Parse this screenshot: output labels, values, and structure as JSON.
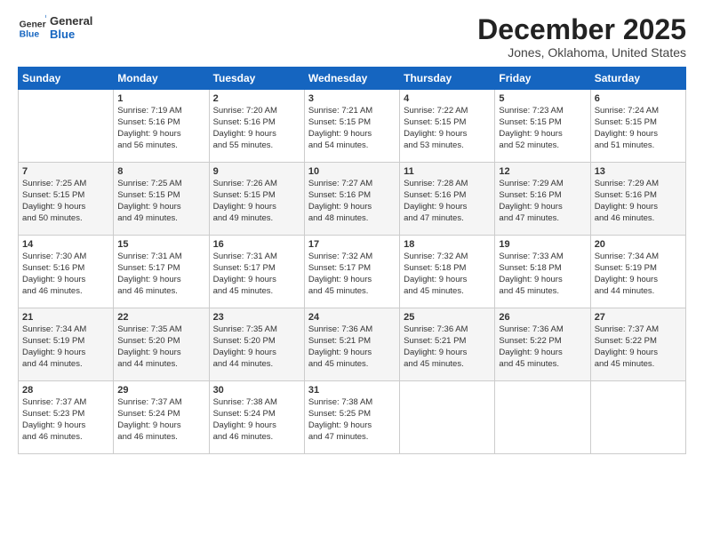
{
  "logo": {
    "line1": "General",
    "line2": "Blue"
  },
  "title": "December 2025",
  "subtitle": "Jones, Oklahoma, United States",
  "header_days": [
    "Sunday",
    "Monday",
    "Tuesday",
    "Wednesday",
    "Thursday",
    "Friday",
    "Saturday"
  ],
  "weeks": [
    [
      {
        "day": "",
        "content": ""
      },
      {
        "day": "1",
        "content": "Sunrise: 7:19 AM\nSunset: 5:16 PM\nDaylight: 9 hours\nand 56 minutes."
      },
      {
        "day": "2",
        "content": "Sunrise: 7:20 AM\nSunset: 5:16 PM\nDaylight: 9 hours\nand 55 minutes."
      },
      {
        "day": "3",
        "content": "Sunrise: 7:21 AM\nSunset: 5:15 PM\nDaylight: 9 hours\nand 54 minutes."
      },
      {
        "day": "4",
        "content": "Sunrise: 7:22 AM\nSunset: 5:15 PM\nDaylight: 9 hours\nand 53 minutes."
      },
      {
        "day": "5",
        "content": "Sunrise: 7:23 AM\nSunset: 5:15 PM\nDaylight: 9 hours\nand 52 minutes."
      },
      {
        "day": "6",
        "content": "Sunrise: 7:24 AM\nSunset: 5:15 PM\nDaylight: 9 hours\nand 51 minutes."
      }
    ],
    [
      {
        "day": "7",
        "content": "Sunrise: 7:25 AM\nSunset: 5:15 PM\nDaylight: 9 hours\nand 50 minutes."
      },
      {
        "day": "8",
        "content": "Sunrise: 7:25 AM\nSunset: 5:15 PM\nDaylight: 9 hours\nand 49 minutes."
      },
      {
        "day": "9",
        "content": "Sunrise: 7:26 AM\nSunset: 5:15 PM\nDaylight: 9 hours\nand 49 minutes."
      },
      {
        "day": "10",
        "content": "Sunrise: 7:27 AM\nSunset: 5:16 PM\nDaylight: 9 hours\nand 48 minutes."
      },
      {
        "day": "11",
        "content": "Sunrise: 7:28 AM\nSunset: 5:16 PM\nDaylight: 9 hours\nand 47 minutes."
      },
      {
        "day": "12",
        "content": "Sunrise: 7:29 AM\nSunset: 5:16 PM\nDaylight: 9 hours\nand 47 minutes."
      },
      {
        "day": "13",
        "content": "Sunrise: 7:29 AM\nSunset: 5:16 PM\nDaylight: 9 hours\nand 46 minutes."
      }
    ],
    [
      {
        "day": "14",
        "content": "Sunrise: 7:30 AM\nSunset: 5:16 PM\nDaylight: 9 hours\nand 46 minutes."
      },
      {
        "day": "15",
        "content": "Sunrise: 7:31 AM\nSunset: 5:17 PM\nDaylight: 9 hours\nand 46 minutes."
      },
      {
        "day": "16",
        "content": "Sunrise: 7:31 AM\nSunset: 5:17 PM\nDaylight: 9 hours\nand 45 minutes."
      },
      {
        "day": "17",
        "content": "Sunrise: 7:32 AM\nSunset: 5:17 PM\nDaylight: 9 hours\nand 45 minutes."
      },
      {
        "day": "18",
        "content": "Sunrise: 7:32 AM\nSunset: 5:18 PM\nDaylight: 9 hours\nand 45 minutes."
      },
      {
        "day": "19",
        "content": "Sunrise: 7:33 AM\nSunset: 5:18 PM\nDaylight: 9 hours\nand 45 minutes."
      },
      {
        "day": "20",
        "content": "Sunrise: 7:34 AM\nSunset: 5:19 PM\nDaylight: 9 hours\nand 44 minutes."
      }
    ],
    [
      {
        "day": "21",
        "content": "Sunrise: 7:34 AM\nSunset: 5:19 PM\nDaylight: 9 hours\nand 44 minutes."
      },
      {
        "day": "22",
        "content": "Sunrise: 7:35 AM\nSunset: 5:20 PM\nDaylight: 9 hours\nand 44 minutes."
      },
      {
        "day": "23",
        "content": "Sunrise: 7:35 AM\nSunset: 5:20 PM\nDaylight: 9 hours\nand 44 minutes."
      },
      {
        "day": "24",
        "content": "Sunrise: 7:36 AM\nSunset: 5:21 PM\nDaylight: 9 hours\nand 45 minutes."
      },
      {
        "day": "25",
        "content": "Sunrise: 7:36 AM\nSunset: 5:21 PM\nDaylight: 9 hours\nand 45 minutes."
      },
      {
        "day": "26",
        "content": "Sunrise: 7:36 AM\nSunset: 5:22 PM\nDaylight: 9 hours\nand 45 minutes."
      },
      {
        "day": "27",
        "content": "Sunrise: 7:37 AM\nSunset: 5:22 PM\nDaylight: 9 hours\nand 45 minutes."
      }
    ],
    [
      {
        "day": "28",
        "content": "Sunrise: 7:37 AM\nSunset: 5:23 PM\nDaylight: 9 hours\nand 46 minutes."
      },
      {
        "day": "29",
        "content": "Sunrise: 7:37 AM\nSunset: 5:24 PM\nDaylight: 9 hours\nand 46 minutes."
      },
      {
        "day": "30",
        "content": "Sunrise: 7:38 AM\nSunset: 5:24 PM\nDaylight: 9 hours\nand 46 minutes."
      },
      {
        "day": "31",
        "content": "Sunrise: 7:38 AM\nSunset: 5:25 PM\nDaylight: 9 hours\nand 47 minutes."
      },
      {
        "day": "",
        "content": ""
      },
      {
        "day": "",
        "content": ""
      },
      {
        "day": "",
        "content": ""
      }
    ]
  ]
}
